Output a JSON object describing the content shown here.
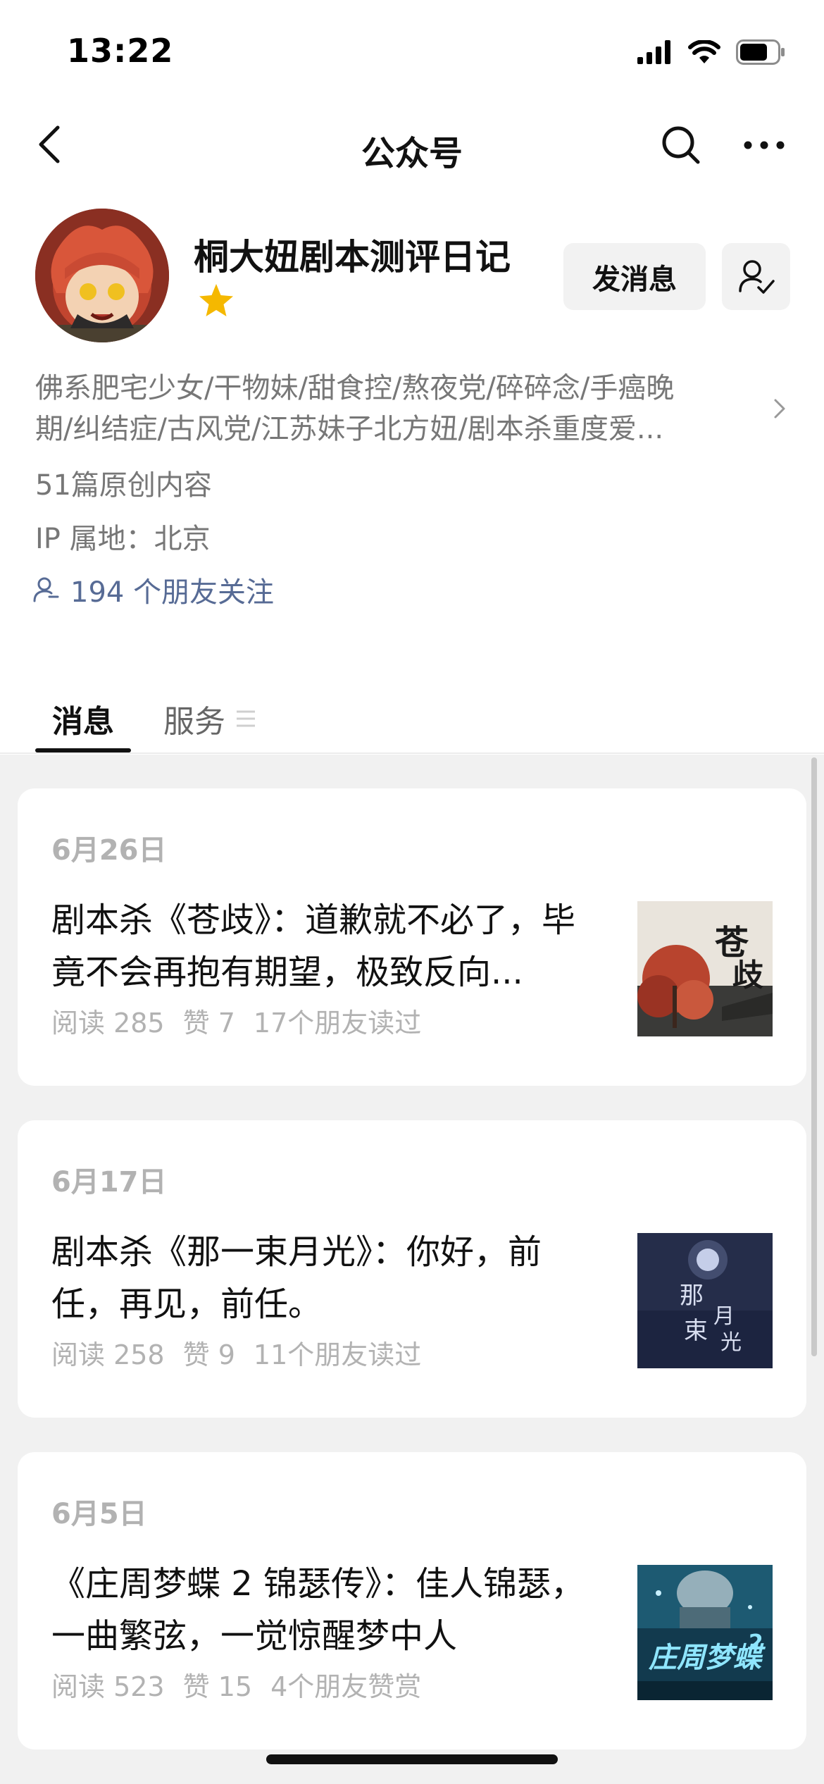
{
  "status_bar": {
    "time": "13:22"
  },
  "nav": {
    "title": "公众号"
  },
  "profile": {
    "name": "桐大妞剧本测评日记",
    "message_button": "发消息",
    "bio_line1": "佛系肥宅少女/干物妹/甜食控/熬夜党/碎碎念/手癌晚",
    "bio_line2": "期/纠结症/古风党/江苏妹子北方妞/剧本杀重度爱...",
    "original_count": "51篇原创内容",
    "ip_location": "IP 属地：北京",
    "friends_follow": "194 个朋友关注"
  },
  "tabs": {
    "messages": "消息",
    "services": "服务"
  },
  "articles": [
    {
      "date": "6月26日",
      "title": "剧本杀《苍歧》：道歉就不必了，毕竟不会再抱有期望，极致反向...",
      "reads": "阅读 285",
      "likes": "赞 7",
      "social": "17个朋友读过"
    },
    {
      "date": "6月17日",
      "title": "剧本杀《那一束月光》：你好，前任，再见，前任。",
      "reads": "阅读 258",
      "likes": "赞 9",
      "social": "11个朋友读过"
    },
    {
      "date": "6月5日",
      "title": "《庄周梦蝶 2 锦瑟传》：佳人锦瑟，一曲繁弦，一觉惊醒梦中人",
      "reads": "阅读 523",
      "likes": "赞 15",
      "social": "4个朋友赞赏"
    }
  ],
  "colors": {
    "link": "#576b95",
    "muted_text": "#777777",
    "meta_text": "#b2b2b2",
    "feed_background": "#f1f1f1",
    "star": "#f5b800"
  },
  "icons": [
    "back-icon",
    "search-icon",
    "more-icon",
    "star-icon",
    "follow-check-icon",
    "chevron-right-icon",
    "friends-icon",
    "menu-lines-icon",
    "signal-icon",
    "wifi-icon",
    "battery-icon"
  ]
}
